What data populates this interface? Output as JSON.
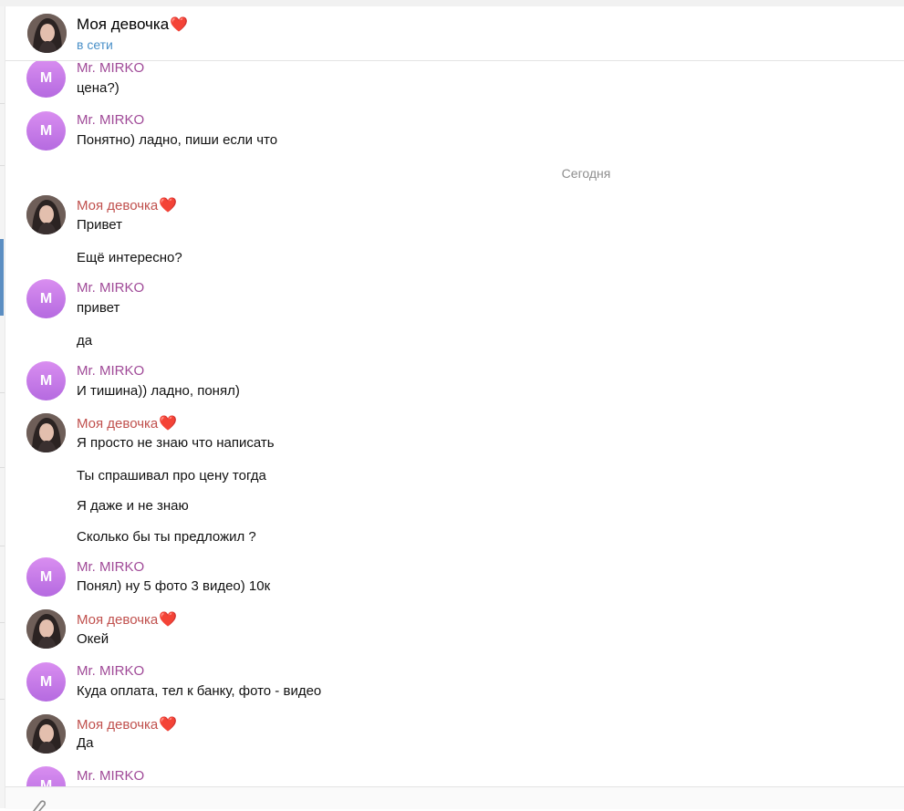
{
  "header": {
    "title": "Моя девочка",
    "status": "в сети"
  },
  "users": {
    "mirko": {
      "name": "Mr. MIRKO",
      "initial": "M"
    },
    "girl": {
      "name": "Моя девочка"
    }
  },
  "heart_glyph": "❤️",
  "date_separator": "Сегодня",
  "messages": [
    {
      "sender": "Mr. MIRKO",
      "lines": [
        "цена?)"
      ]
    },
    {
      "sender": "Mr. MIRKO",
      "lines": [
        "Понятно) ладно, пиши если что"
      ]
    },
    {
      "sender": "Моя девочка",
      "lines": [
        "Привет",
        "Ещё интересно?"
      ]
    },
    {
      "sender": "Mr. MIRKO",
      "lines": [
        "привет",
        "да"
      ]
    },
    {
      "sender": "Mr. MIRKO",
      "lines": [
        "И тишина)) ладно, понял)"
      ]
    },
    {
      "sender": "Моя девочка",
      "lines": [
        "Я просто не знаю что написать",
        "Ты спрашивал про цену тогда",
        "Я даже и не знаю",
        "Сколько бы ты предложил ?"
      ]
    },
    {
      "sender": "Mr. MIRKO",
      "lines": [
        "Понял) ну 5 фото 3 видео) 10к"
      ]
    },
    {
      "sender": "Моя девочка",
      "lines": [
        "Окей"
      ]
    },
    {
      "sender": "Mr. MIRKO",
      "lines": [
        "Куда оплата, тел к банку, фото - видео"
      ]
    },
    {
      "sender": "Моя девочка",
      "lines": [
        "Да"
      ]
    },
    {
      "sender": "Mr. MIRKO",
      "lines": []
    }
  ],
  "icons": {
    "attach": "paperclip-icon"
  }
}
